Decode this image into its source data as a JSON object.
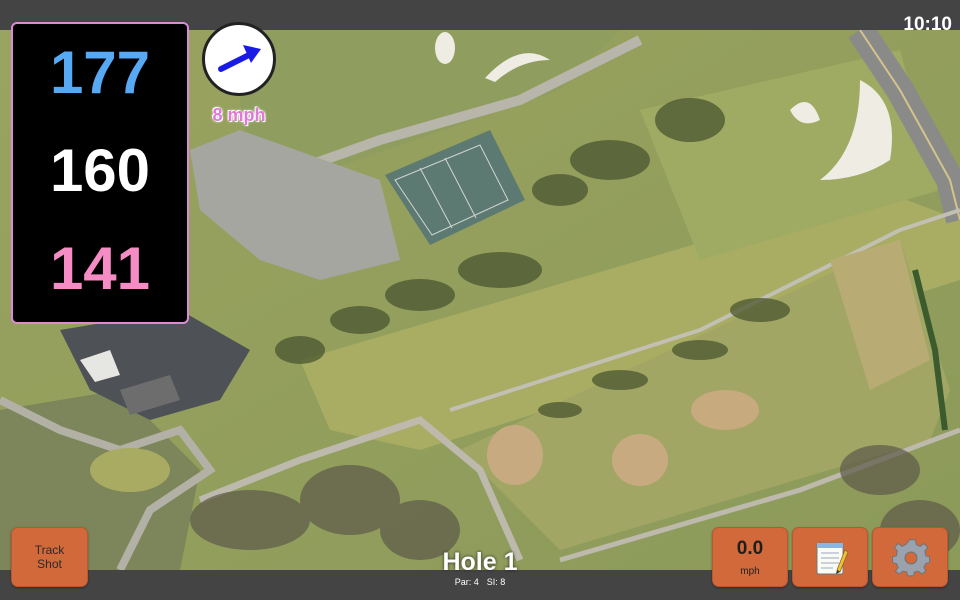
{
  "status_bar": {
    "time": "10:10"
  },
  "yardages": {
    "back": "177",
    "middle": "160",
    "front": "141"
  },
  "wind": {
    "speed": "8 mph",
    "direction_icon": "arrow-icon"
  },
  "track_shot": {
    "line1": "Track",
    "line2": "Shot"
  },
  "speed": {
    "value": "0.0",
    "unit": "mph"
  },
  "hole": {
    "title": "Hole 1",
    "par": "Par: 4",
    "si": "SI: 8"
  },
  "icons": {
    "notes": "notepad-icon",
    "settings": "gear-icon"
  },
  "colors": {
    "back_yardage": "#58a9f3",
    "middle_yardage": "#ffffff",
    "front_yardage": "#f58cc3",
    "button": "#d2693b",
    "wind_text": "#e07ad6",
    "wind_arrow": "#1a1ae6"
  }
}
